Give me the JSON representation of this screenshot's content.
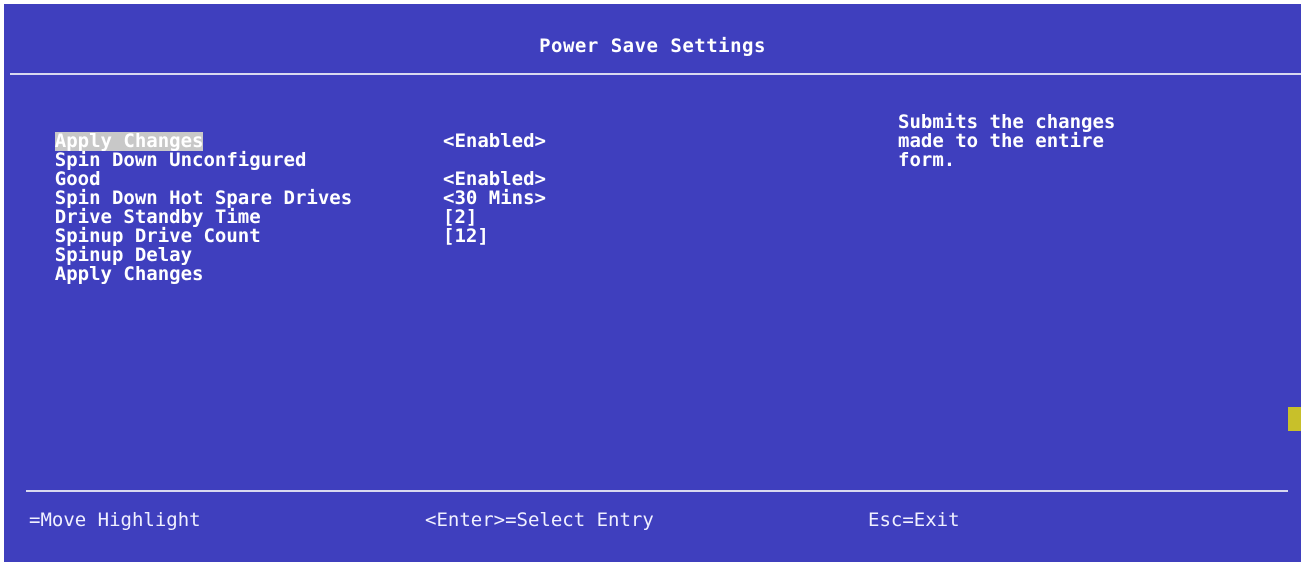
{
  "title": "Power Save Settings",
  "menu": {
    "highlighted_item": "Apply Changes",
    "items": [
      {
        "label_line1": "Spin Down Unconfigured",
        "label_line2": "Good",
        "value": "<Enabled>"
      },
      {
        "label": "Spin Down Hot Spare Drives",
        "value": "<Enabled>"
      },
      {
        "label": "Drive Standby Time",
        "value": "<30 Mins>"
      },
      {
        "label": "Spinup Drive Count",
        "value": "[2]"
      },
      {
        "label": "Spinup Delay",
        "value": "[12]"
      },
      {
        "label": "Apply Changes"
      }
    ]
  },
  "help": {
    "lines": [
      "Submits the changes",
      "made to the entire",
      "form."
    ]
  },
  "footer": {
    "move": "=Move Highlight",
    "select": "<Enter>=Select Entry",
    "exit": "Esc=Exit"
  },
  "colors": {
    "background": "#3f3fbe",
    "highlight": "#c8c8c8",
    "scroll_marker": "#c8c02a"
  }
}
